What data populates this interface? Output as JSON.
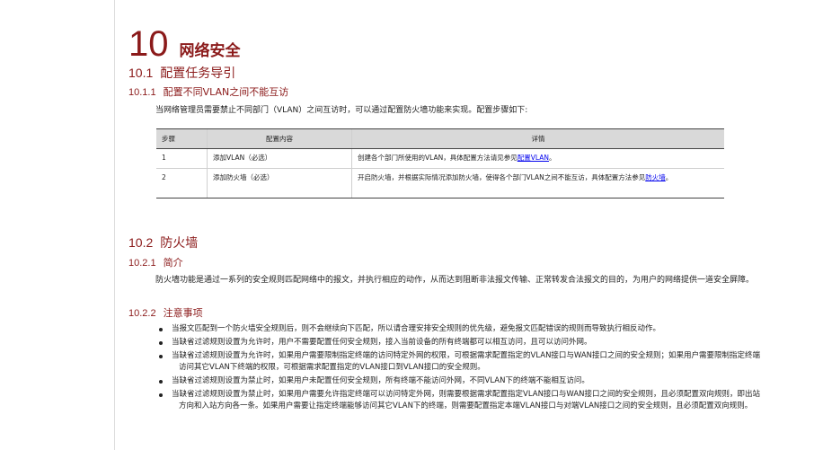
{
  "chapter": {
    "number": "10",
    "title": "网络安全"
  },
  "sections": {
    "s1": {
      "number": "10.1",
      "title": "配置任务导引"
    },
    "s1_1": {
      "number": "10.1.1",
      "title": "配置不同VLAN之间不能互访"
    },
    "s1_1_intro": "当网络管理员需要禁止不同部门（VLAN）之间互访时，可以通过配置防火墙功能来实现。配置步骤如下:",
    "s2": {
      "number": "10.2",
      "title": "防火墙"
    },
    "s2_1": {
      "number": "10.2.1",
      "title": "简介"
    },
    "s2_1_body": "防火墙功能是通过一系列的安全规则匹配网络中的报文，并执行相应的动作，从而达到阻断非法报文传输、正常转发合法报文的目的，为用户的网络提供一道安全屏障。",
    "s2_2": {
      "number": "10.2.2",
      "title": "注意事项"
    }
  },
  "table": {
    "headers": [
      "步骤",
      "配置内容",
      "详情"
    ],
    "rows": [
      {
        "step": "1",
        "content": "添加VLAN（必选）",
        "detail": "创建各个部门所使用的VLAN，具体配置方法请见参见",
        "link": "配置VLAN",
        "tail": "。"
      },
      {
        "step": "2",
        "content": "添加防火墙（必选）",
        "detail": "开启防火墙，并根据实际情况添加防火墙，使得各个部门VLAN之间不能互访，具体配置方法参见",
        "link": "防火墙",
        "tail": "。"
      }
    ]
  },
  "notes": [
    "当报文匹配到一个防火墙安全规则后，则不会继续向下匹配，所以请合理安排安全规则的优先级，避免报文匹配错误的规则而导致执行相反动作。",
    "当缺省过滤规则设置为允许时，用户不需要配置任何安全规则，接入当前设备的所有终端都可以相互访问，且可以访问外网。",
    "当缺省过滤规则设置为允许时，如果用户需要限制指定终端的访问特定外网的权限，可根据需求配置指定的VLAN接口与WAN接口之间的安全规则；如果用户需要限制指定终端访问其它VLAN下终端的权限，可根据需求配置指定的VLAN接口到VLAN接口的安全规则。",
    "当缺省过滤规则设置为禁止时，如果用户未配置任何安全规则，所有终端不能访问外网，不同VLAN下的终端不能相互访问。",
    "当缺省过滤规则设置为禁止时，如果用户需要允许指定终端可以访问特定外网，则需要根据需求配置指定VLAN接口与WAN接口之间的安全规则，且必须配置双向规则，即出站方向和入站方向各一条。如果用户需要让指定终端能够访问其它VLAN下的终端，则需要配置指定本端VLAN接口与对端VLAN接口之间的安全规则，且必须配置双向规则。"
  ]
}
